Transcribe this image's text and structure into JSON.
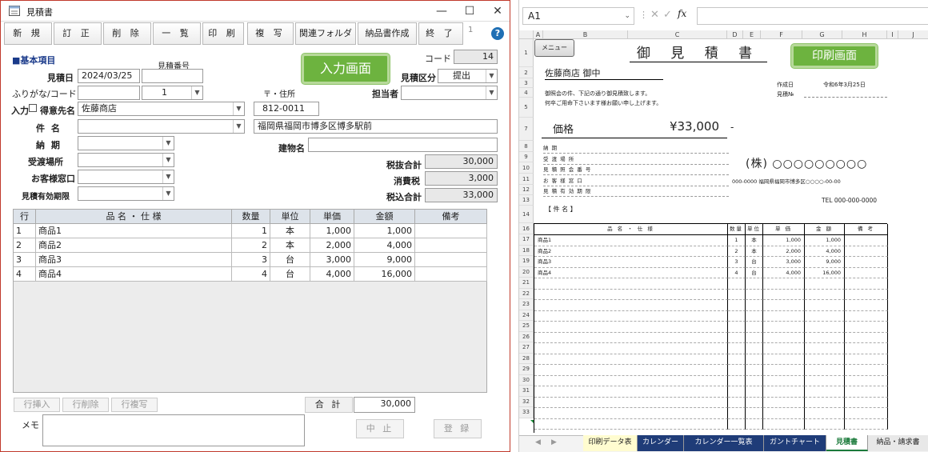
{
  "window": {
    "title": "見積書"
  },
  "toolbar": {
    "buttons": [
      "新 規",
      "訂 正",
      "削 除",
      "一 覧",
      "印 刷",
      "複 写",
      "関連フォルダ",
      "納品書作成",
      "終 了"
    ],
    "page_num": "1"
  },
  "form": {
    "section_title": "■基本項目",
    "code_label": "コード",
    "code_value": "14",
    "quote_date_label": "見積日",
    "quote_date": "2024/03/25",
    "quote_no_label": "見積番号",
    "quote_no": "",
    "kubun_label": "見積区分",
    "kubun_value": "提出",
    "kana_label": "ふりがな/コード",
    "kana_code": "1",
    "address_label": "〒・住所",
    "tantou_label": "担当者",
    "nyuryoku_label": "入力",
    "tokuisaki_label": "得意先名",
    "tokuisaki": "佐藤商店",
    "zip": "812-0011",
    "address": "福岡県福岡市博多区博多駅前",
    "kenmei_label": "件 名",
    "noki_label": "納 期",
    "building_label": "建物名",
    "ukewatashi_label": "受渡場所",
    "madoguchi_label": "お客様窓口",
    "yuko_label": "見積有効期限",
    "subtotal_label": "税抜合計",
    "subtotal": "30,000",
    "tax_label": "消費税",
    "tax": "3,000",
    "total_label": "税込合計",
    "total": "33,000",
    "input_badge": "入力画面"
  },
  "grid": {
    "headers": [
      "行",
      "品 名 ・ 仕 様",
      "数量",
      "単位",
      "単価",
      "金額",
      "備考"
    ],
    "rows": [
      [
        "1",
        "商品1",
        "1",
        "本",
        "1,000",
        "1,000",
        ""
      ],
      [
        "2",
        "商品2",
        "2",
        "本",
        "2,000",
        "4,000",
        ""
      ],
      [
        "3",
        "商品3",
        "3",
        "台",
        "3,000",
        "9,000",
        ""
      ],
      [
        "4",
        "商品4",
        "4",
        "台",
        "4,000",
        "16,000",
        ""
      ]
    ]
  },
  "footer": {
    "insert": "行挿入",
    "delete": "行削除",
    "copy": "行複写",
    "sum_label": "合 計",
    "sum": "30,000",
    "memo_label": "メモ",
    "cancel": "中 止",
    "register": "登 録"
  },
  "excel": {
    "namebox": "A1",
    "menu_btn": "メニュー",
    "title": "御 見 積 書",
    "print_badge": "印刷画面",
    "customer": "佐藤商店 御中",
    "created_label": "作成日",
    "created": "令和6年3月25日",
    "quote_no_label": "見積№",
    "intro1": "御照会の件、下記の通り御見積致します。",
    "intro2": "何卒ご用命下さいます様お願い申し上げます。",
    "price_label": "価格",
    "price": "¥33,000",
    "price_dash": "-",
    "info": [
      "納 期",
      "受 渡 場 所",
      "見 積 照 会 番 号",
      "お 客 様 窓 口",
      "見 積 有 効 期 限"
    ],
    "company": "(株) ○○○○○○○○○",
    "company_addr": "000-0000 福岡県福岡市博多区○○○○-00-00",
    "tel": "TEL 000-000-0000",
    "kenmei": "【 件 名 】",
    "table_headers": [
      "品 名 ・ 仕 様",
      "数量",
      "単位",
      "単 価",
      "金 額",
      "備 考"
    ],
    "rows": [
      [
        "商品1",
        "1",
        "本",
        "1,000",
        "1,000"
      ],
      [
        "商品2",
        "2",
        "本",
        "2,000",
        "4,000"
      ],
      [
        "商品3",
        "3",
        "台",
        "3,000",
        "9,000"
      ],
      [
        "商品4",
        "4",
        "台",
        "4,000",
        "16,000"
      ]
    ],
    "col_letters": [
      "A",
      "B",
      "C",
      "D",
      "E",
      "F",
      "G",
      "H",
      "I",
      "J"
    ],
    "row_numbers": [
      "1",
      "2",
      "3",
      "4",
      "5",
      "7",
      "8",
      "9",
      "10",
      "11",
      "12",
      "13",
      "14",
      "16",
      "17",
      "18",
      "19",
      "20",
      "21",
      "22",
      "23",
      "24",
      "25",
      "26",
      "27",
      "28",
      "29",
      "30",
      "31",
      "32",
      "33"
    ],
    "tabs": [
      "印刷データ表",
      "カレンダー",
      "カレンダー一覧表",
      "ガントチャート",
      "見積書",
      "納品・請求書"
    ]
  }
}
